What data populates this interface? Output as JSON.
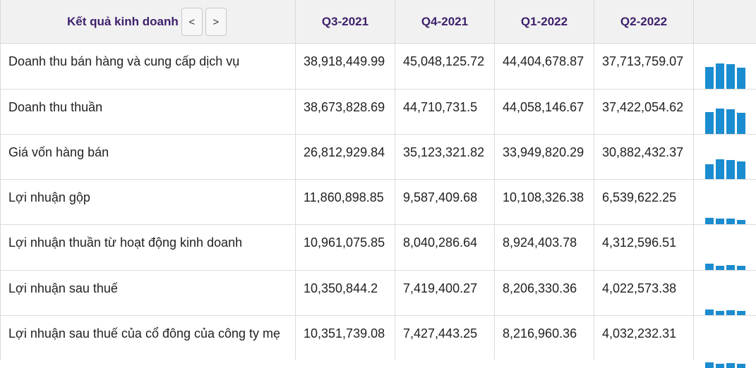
{
  "header": {
    "title": "Kết quả kinh doanh",
    "prev_label": "<",
    "next_label": ">",
    "periods": [
      "Q3-2021",
      "Q4-2021",
      "Q1-2022",
      "Q2-2022"
    ]
  },
  "rows": [
    {
      "label": "Doanh thu bán hàng và cung cấp dịch vụ",
      "values": [
        "38,918,449.99",
        "45,048,125.72",
        "44,404,678.87",
        "37,713,759.07"
      ],
      "spark": [
        38918449.99,
        45048125.72,
        44404678.87,
        37713759.07
      ]
    },
    {
      "label": "Doanh thu thuần",
      "values": [
        "38,673,828.69",
        "44,710,731.5",
        "44,058,146.67",
        "37,422,054.62"
      ],
      "spark": [
        38673828.69,
        44710731.5,
        44058146.67,
        37422054.62
      ]
    },
    {
      "label": "Giá vốn hàng bán",
      "values": [
        "26,812,929.84",
        "35,123,321.82",
        "33,949,820.29",
        "30,882,432.37"
      ],
      "spark": [
        26812929.84,
        35123321.82,
        33949820.29,
        30882432.37
      ]
    },
    {
      "label": "Lợi nhuận gộp",
      "values": [
        "11,860,898.85",
        "9,587,409.68",
        "10,108,326.38",
        "6,539,622.25"
      ],
      "spark": [
        11860898.85,
        9587409.68,
        10108326.38,
        6539622.25
      ]
    },
    {
      "label": "Lợi nhuận thuần từ hoạt động kinh doanh",
      "values": [
        "10,961,075.85",
        "8,040,286.64",
        "8,924,403.78",
        "4,312,596.51"
      ],
      "spark": [
        10961075.85,
        8040286.64,
        8924403.78,
        4312596.51
      ]
    },
    {
      "label": "Lợi nhuận sau thuế",
      "values": [
        "10,350,844.2",
        "7,419,400.27",
        "8,206,330.36",
        "4,022,573.38"
      ],
      "spark": [
        10350844.2,
        7419400.27,
        8206330.36,
        4022573.38
      ]
    },
    {
      "label": "Lợi nhuận sau thuế của cổ đông của công ty mẹ",
      "values": [
        "10,351,739.08",
        "7,427,443.25",
        "8,216,960.36",
        "4,032,232.31"
      ],
      "spark": [
        10351739.08,
        7427443.25,
        8216960.36,
        4032232.31
      ]
    }
  ],
  "colors": {
    "bar": "#1b8ccf",
    "header_text": "#3d1f6b",
    "header_bg": "#f1f1f1"
  }
}
